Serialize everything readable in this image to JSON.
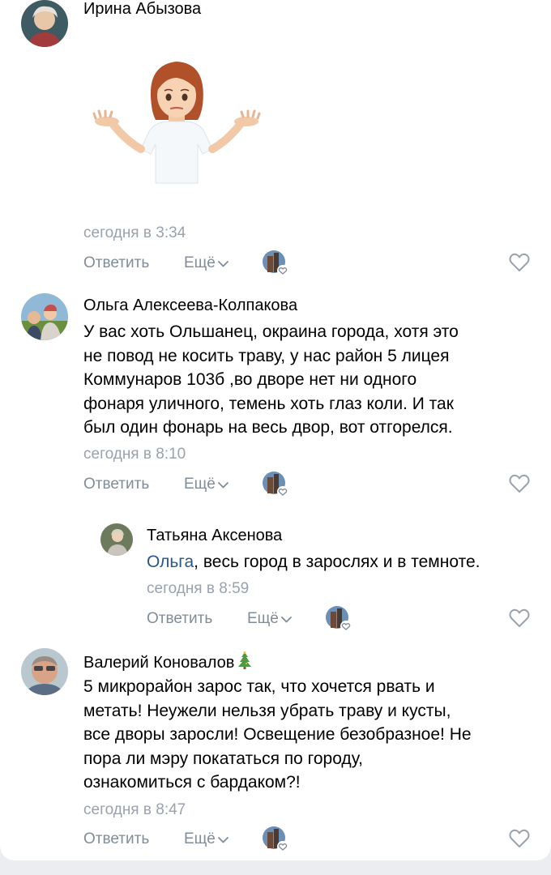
{
  "comments": [
    {
      "author": "Ирина Абызова",
      "time": "сегодня в 3:34",
      "reply": "Ответить",
      "more": "Ещё"
    },
    {
      "author": "Ольга Алексеева-Колпакова",
      "lines": [
        "У вас хоть Ольшанец, окраина города, хотя это",
        "не повод не косить траву, у нас район 5 лицея",
        "Коммунаров 103б ,во дворе нет ни одного",
        "фонаря уличного, темень хоть глаз коли. И так",
        "был один фонарь на весь двор, вот отгорелся."
      ],
      "time": "сегодня в 8:10",
      "reply": "Ответить",
      "more": "Ещё"
    },
    {
      "author": "Татьяна Аксенова",
      "mention": "Ольга",
      "text": ", весь город в зарослях и в темноте.",
      "time": "сегодня в 8:59",
      "reply": "Ответить",
      "more": "Ещё"
    },
    {
      "author": "Валерий Коновалов",
      "lines": [
        "5 микрорайон зарос так, что хочется рвать и",
        "метать! Неужели нельзя убрать траву и кусты,",
        "все дворы заросли! Освещение безобразное! Не",
        "пора ли мэру покататься по городу,",
        "ознакомиться с бардаком?!"
      ],
      "time": "сегодня в 8:47",
      "reply": "Ответить",
      "more": "Ещё"
    }
  ],
  "colors": {
    "link": "#2a5885",
    "meta": "#99a2ad",
    "action": "#818c99",
    "background": "#ebedf0"
  },
  "icons": [
    "sticker-shrug",
    "chevron-down-icon",
    "heart-icon",
    "liker-avatar-icon",
    "christmas-tree-icon"
  ]
}
